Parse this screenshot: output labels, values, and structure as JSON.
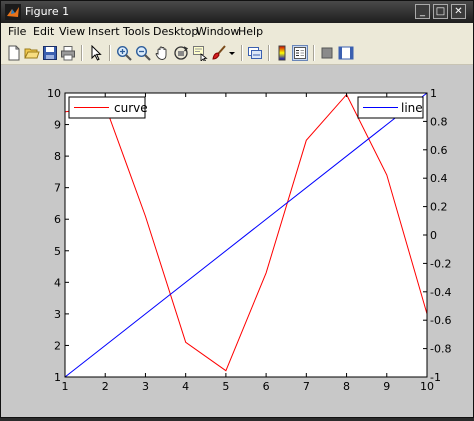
{
  "window": {
    "title": "Figure 1",
    "controls": {
      "minimize": "_",
      "maximize": "□",
      "close": "✕"
    }
  },
  "menubar": {
    "items": [
      "File",
      "Edit",
      "View",
      "Insert",
      "Tools",
      "Desktop",
      "Window",
      "Help"
    ]
  },
  "toolbar": {
    "buttons": [
      "new-figure",
      "open-file",
      "save-figure",
      "print-figure",
      "edit-plot",
      "zoom-in",
      "zoom-out",
      "pan",
      "rotate-3d",
      "data-cursor",
      "brush",
      "brush-dropdown",
      "link-plot",
      "insert-colorbar",
      "insert-legend",
      "hide-plot-tools",
      "show-plot-tools"
    ]
  },
  "chart_data": {
    "type": "line",
    "xlim": [
      1,
      10
    ],
    "ylim_left": [
      1,
      10
    ],
    "ylim_right": [
      -1,
      1
    ],
    "x_ticks": [
      "1",
      "2",
      "3",
      "4",
      "5",
      "6",
      "7",
      "8",
      "9",
      "10"
    ],
    "y_left_ticks": [
      "1",
      "2",
      "3",
      "4",
      "5",
      "6",
      "7",
      "8",
      "9",
      "10"
    ],
    "y_right_ticks": [
      "1",
      "0.8",
      "0.6",
      "0.4",
      "0.2",
      "0",
      "-0.2",
      "-0.4",
      "-0.6",
      "-0.8",
      "-1"
    ],
    "grid": false,
    "series": [
      {
        "name": "curve",
        "axis": "left",
        "color": "#ff0000",
        "x": [
          1,
          2,
          3,
          4,
          5,
          6,
          7,
          8,
          9,
          10
        ],
        "y": [
          9.4,
          9.6,
          6.1,
          2.1,
          1.2,
          4.3,
          8.5,
          9.95,
          7.4,
          3.0
        ]
      },
      {
        "name": "line",
        "axis": "right",
        "color": "#0000ff",
        "x": [
          1,
          10
        ],
        "y": [
          -1,
          1
        ]
      }
    ],
    "legends": [
      {
        "position": "top-left",
        "entries": [
          "curve"
        ]
      },
      {
        "position": "top-right",
        "entries": [
          "line"
        ]
      }
    ]
  },
  "colors": {
    "titlebar": "#2a2a2a",
    "chrome": "#ece9d8",
    "figure_bg": "#c8c8c8",
    "axes_bg": "#ffffff"
  }
}
